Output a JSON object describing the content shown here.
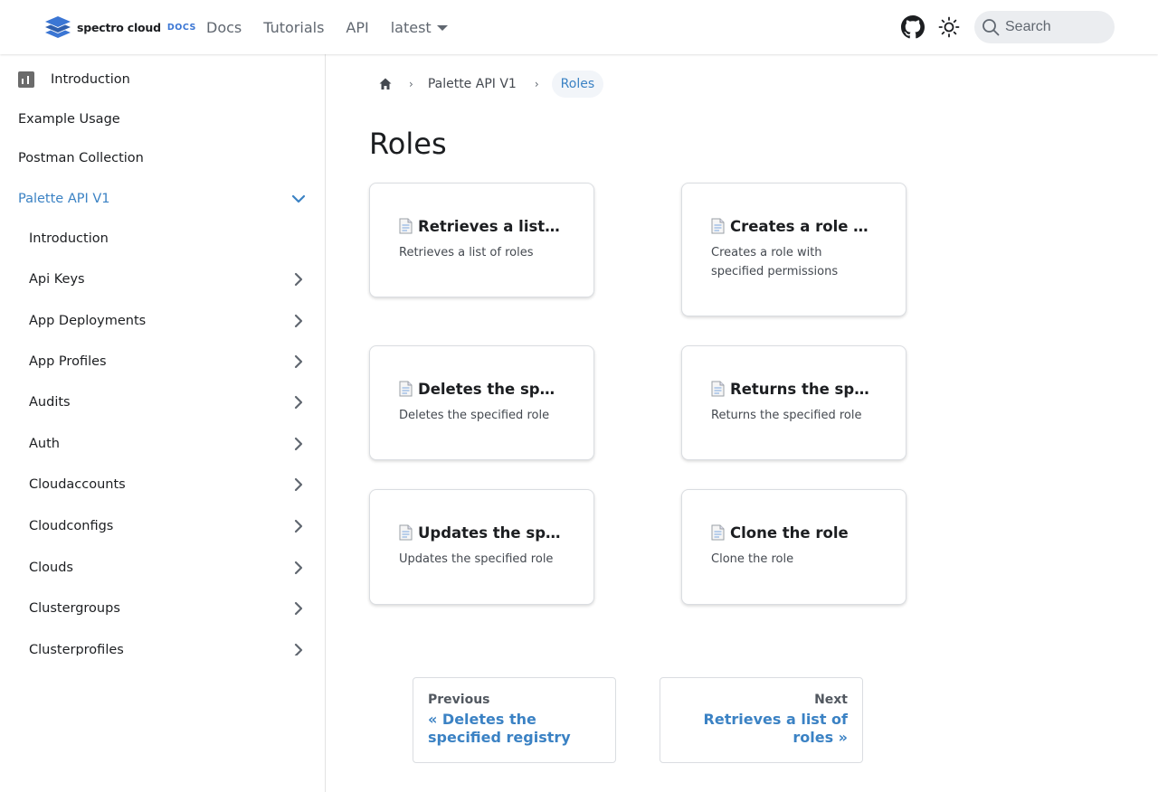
{
  "brand": {
    "name": "spectro cloud",
    "suffix": "DOCS",
    "accent": "#3b76d4"
  },
  "nav": {
    "links": [
      "Docs",
      "Tutorials",
      "API"
    ],
    "version": "latest",
    "search_placeholder": "Search"
  },
  "sidebar": {
    "top_items": [
      "Introduction",
      "Example Usage",
      "Postman Collection"
    ],
    "active_section": "Palette API V1",
    "sub_items": [
      "Introduction",
      "Api Keys",
      "App Deployments",
      "App Profiles",
      "Audits",
      "Auth",
      "Cloudaccounts",
      "Cloudconfigs",
      "Clouds",
      "Clustergroups",
      "Clusterprofiles"
    ]
  },
  "breadcrumb": {
    "parent": "Palette API V1",
    "current": "Roles"
  },
  "page": {
    "title": "Roles"
  },
  "cards": [
    {
      "title": "Retrieves a list of roles",
      "desc": "Retrieves a list of roles"
    },
    {
      "title": "Creates a role with specified permissions",
      "desc": "Creates a role with specified permissions"
    },
    {
      "title": "Deletes the specified role",
      "desc": "Deletes the specified role"
    },
    {
      "title": "Returns the specified role",
      "desc": "Returns the specified role"
    },
    {
      "title": "Updates the specified role",
      "desc": "Updates the specified role"
    },
    {
      "title": "Clone the role",
      "desc": "Clone the role"
    }
  ],
  "pagination": {
    "prev_sub": "Previous",
    "prev_label": "« Deletes the specified registry",
    "next_sub": "Next",
    "next_label": "Retrieves a list of roles »"
  },
  "colors": {
    "link": "#3b82c4",
    "text": "#1c1e21",
    "muted": "#606770"
  }
}
